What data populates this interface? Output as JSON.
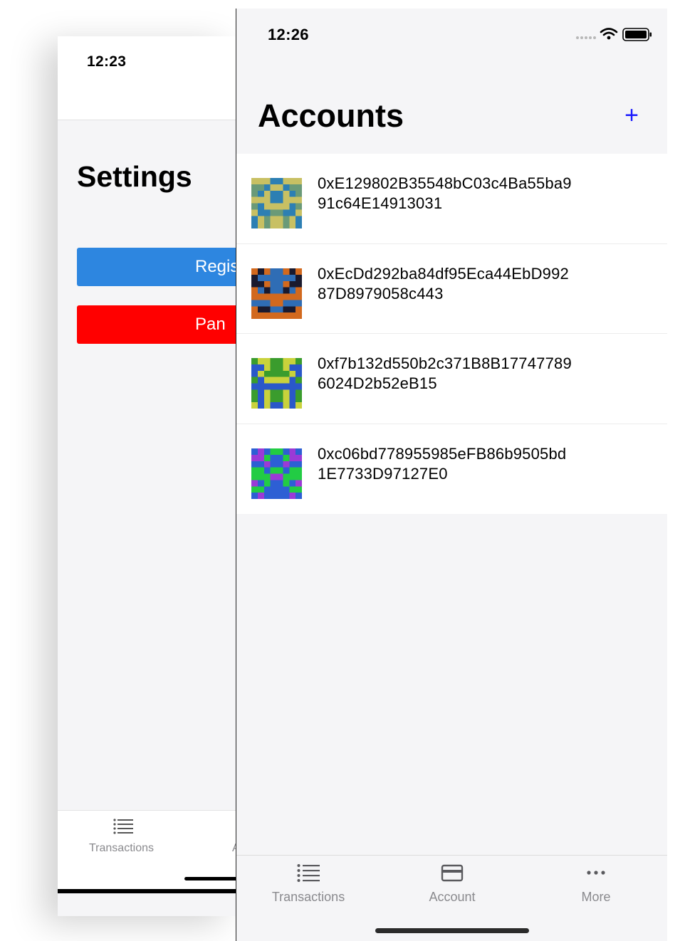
{
  "back_screen": {
    "time": "12:23",
    "title": "Settings",
    "register_button": "Regis",
    "panic_button": "Pan",
    "tab_transactions": "Transactions",
    "tab_partial": "A"
  },
  "status_bar": {
    "time": "12:26"
  },
  "header": {
    "title": "Accounts",
    "add_label": "+"
  },
  "accounts": [
    {
      "address": "0xE129802B35548bC03c4Ba55ba991c64E14913031",
      "colors": [
        "#c8c063",
        "#2d7fb3",
        "#6a9a78"
      ]
    },
    {
      "address": "0xEcDd292ba84df95Eca44EbD99287D8979058c443",
      "colors": [
        "#d2691e",
        "#1a1a2e",
        "#2f6db5"
      ]
    },
    {
      "address": "0xf7b132d550b2c371B8B177477896024D2b52eB15",
      "colors": [
        "#3a9c2d",
        "#2a58c9",
        "#c9d23c"
      ]
    },
    {
      "address": "0xc06bd778955985eFB86b9505bd1E7733D97127E0",
      "colors": [
        "#22cc44",
        "#2d5fd4",
        "#9b3ad6"
      ]
    }
  ],
  "tabs": [
    {
      "label": "Transactions",
      "icon": "list-icon"
    },
    {
      "label": "Account",
      "icon": "card-icon"
    },
    {
      "label": "More",
      "icon": "ellipsis-icon"
    }
  ]
}
